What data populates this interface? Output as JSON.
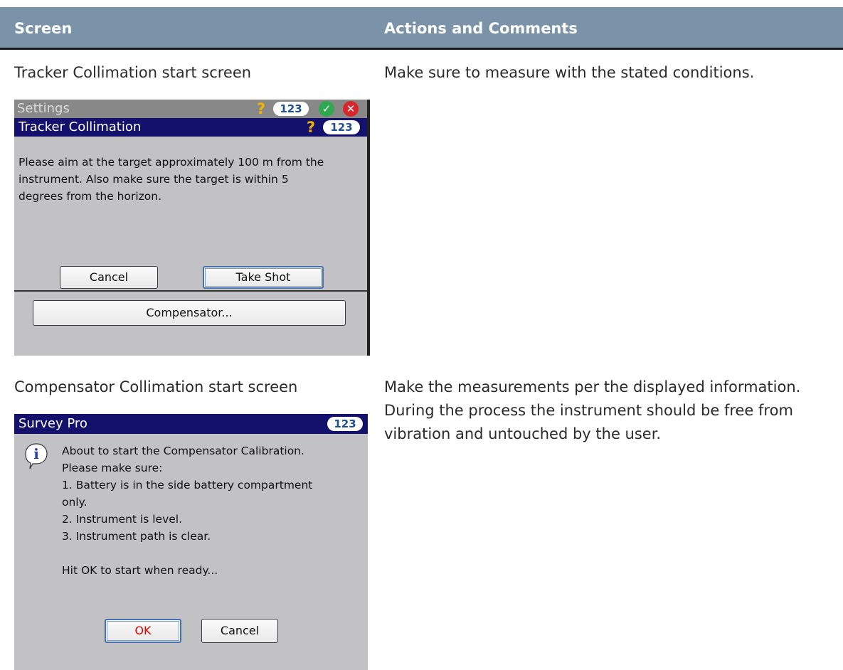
{
  "header": {
    "col1": "Screen",
    "col2": "Actions and Comments"
  },
  "rows": [
    {
      "caption": "Tracker Collimation start screen",
      "comment_lines": [
        "Make sure to measure with the stated conditions."
      ]
    },
    {
      "caption": "Compensator Collimation start screen",
      "comment_lines": [
        "Make the measurements per the displayed information.",
        "During the process the instrument should be free from",
        "vibration and untouched by the user."
      ]
    }
  ],
  "screen1": {
    "outer_title": "Settings",
    "outer_badge": "123",
    "inner_title": "Tracker Collimation",
    "inner_badge": "123",
    "message_lines": [
      "Please aim at the target approximately 100 m from the",
      "instrument.  Also make sure the target is within 5",
      "degrees from the horizon."
    ],
    "cancel_label": "Cancel",
    "take_shot_label": "Take Shot",
    "compensator_label": "Compensator..."
  },
  "screen2": {
    "title": "Survey Pro",
    "badge": "123",
    "message_lines": [
      "About to start the Compensator Calibration.",
      "Please make sure:",
      "1. Battery is in the side battery compartment",
      "only.",
      "2. Instrument is level.",
      "3. Instrument path is clear.",
      "",
      "Hit OK to start when ready..."
    ],
    "ok_label": "OK",
    "cancel_label": "Cancel"
  },
  "colors": {
    "header_bg": "#7a93a8",
    "titlebar_blue": "#13116b",
    "device_bg": "#c2c1c4",
    "ok_text": "#e00000",
    "check_green": "#2fa84f",
    "close_red": "#d9262c",
    "help_yellow": "#f0b400"
  },
  "icons": [
    "help-icon",
    "check-icon",
    "close-icon",
    "info-icon"
  ]
}
